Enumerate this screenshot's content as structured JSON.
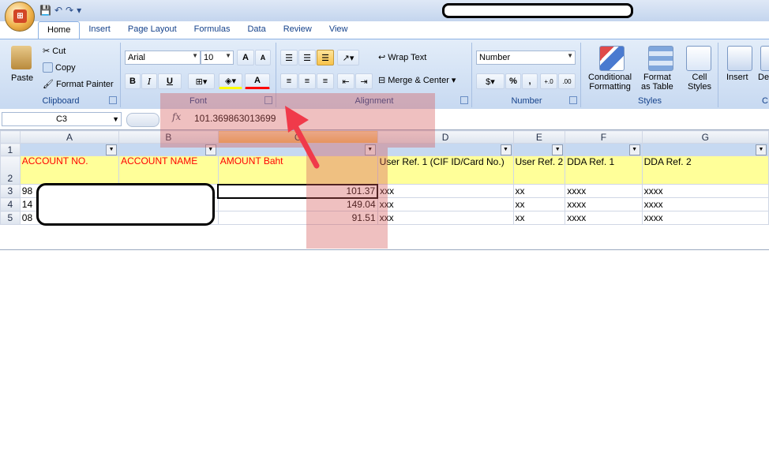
{
  "qat": {
    "save": "💾",
    "undo": "↶",
    "redo": "↷",
    "customize": "▾"
  },
  "tabs": [
    "Home",
    "Insert",
    "Page Layout",
    "Formulas",
    "Data",
    "Review",
    "View"
  ],
  "clipboard": {
    "label": "Clipboard",
    "paste": "Paste",
    "cut": "Cut",
    "copy": "Copy",
    "format_painter": "Format Painter"
  },
  "font": {
    "label": "Font",
    "name": "Arial",
    "size": "10",
    "bold": "B",
    "italic": "I",
    "underline": "U",
    "grow": "A",
    "shrink": "A",
    "color_a": "A"
  },
  "alignment": {
    "label": "Alignment",
    "wrap_text": "Wrap Text",
    "merge_center": "Merge & Center"
  },
  "number": {
    "label": "Number",
    "format": "Number",
    "percent": "%",
    "comma": ",",
    "inc_decimal": "+.0\n.00",
    "dec_decimal": ".00\n→.0"
  },
  "styles": {
    "label": "Styles",
    "conditional": "Conditional",
    "conditional2": "Formatting",
    "format_as": "Format",
    "format_as2": "as Table",
    "cell": "Cell",
    "cell2": "Styles"
  },
  "cells": {
    "insert": "Insert",
    "delete": "De",
    "label": "C"
  },
  "formula_bar": {
    "cell_ref": "C3",
    "fx": "fx",
    "value": "101.369863013699"
  },
  "columns": [
    "A",
    "B",
    "C",
    "D",
    "E",
    "F",
    "G"
  ],
  "rows": [
    "1",
    "2",
    "3",
    "4",
    "5"
  ],
  "headers": {
    "a": "ACCOUNT NO.",
    "b": "ACCOUNT NAME",
    "c": "AMOUNT Baht",
    "d": "User Ref.  1 (CIF ID/Card  No.)",
    "e": "User Ref. 2",
    "f": "DDA Ref. 1",
    "g": "DDA Ref. 2"
  },
  "data": [
    {
      "a": "98",
      "c": "101.37",
      "d": "xxx",
      "e": "xx",
      "f": "xxxx",
      "g": "xxxx"
    },
    {
      "a": "14",
      "c": "149.04",
      "d": "xxx",
      "e": "xx",
      "f": "xxxx",
      "g": "xxxx"
    },
    {
      "a": "08",
      "c": "91.51",
      "d": "xxx",
      "e": "xx",
      "f": "xxxx",
      "g": "xxxx"
    }
  ],
  "colors": {
    "header_fill": "#ffff99",
    "header_text": "#ff0000",
    "filter_fill": "#c6d9f1",
    "highlight": "#d65a5a",
    "arrow": "#f03a4a"
  }
}
